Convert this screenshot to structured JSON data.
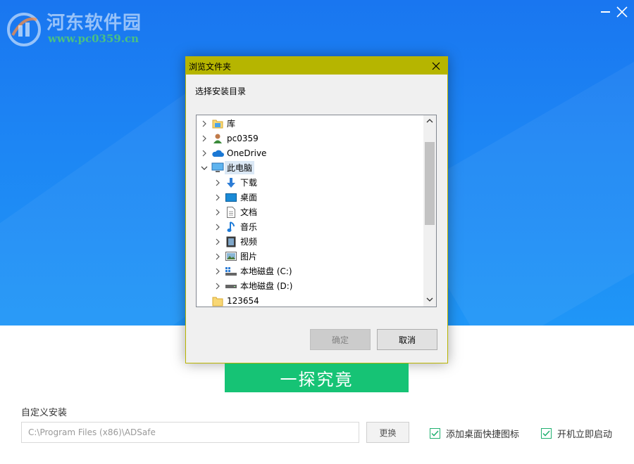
{
  "watermark": {
    "site_name": "河东软件园",
    "site_url": "www.pc0359.cn"
  },
  "window": {
    "minimize_icon": "minimize-icon",
    "close_icon": "close-icon"
  },
  "dialog": {
    "title": "浏览文件夹",
    "prompt": "选择安装目录",
    "tree": [
      {
        "label": "库",
        "icon": "library-icon",
        "level": 0,
        "expanded": false
      },
      {
        "label": "pc0359",
        "icon": "user-icon",
        "level": 0,
        "expanded": false
      },
      {
        "label": "OneDrive",
        "icon": "cloud-icon",
        "level": 0,
        "expanded": false
      },
      {
        "label": "此电脑",
        "icon": "computer-icon",
        "level": 0,
        "expanded": true,
        "selected": true
      },
      {
        "label": "下载",
        "icon": "download-icon",
        "level": 1,
        "expanded": false
      },
      {
        "label": "桌面",
        "icon": "desktop-icon",
        "level": 1,
        "expanded": false
      },
      {
        "label": "文档",
        "icon": "document-icon",
        "level": 1,
        "expanded": false
      },
      {
        "label": "音乐",
        "icon": "music-icon",
        "level": 1,
        "expanded": false
      },
      {
        "label": "视频",
        "icon": "video-icon",
        "level": 1,
        "expanded": false
      },
      {
        "label": "图片",
        "icon": "picture-icon",
        "level": 1,
        "expanded": false
      },
      {
        "label": "本地磁盘 (C:)",
        "icon": "drive-icon",
        "level": 1,
        "expanded": false
      },
      {
        "label": "本地磁盘 (D:)",
        "icon": "drive-icon",
        "level": 1,
        "expanded": false
      },
      {
        "label": "123654",
        "icon": "folder-icon",
        "level": 0,
        "expanded": null
      }
    ],
    "ok_label": "确定",
    "cancel_label": "取消",
    "title_bar_color": "#b6b500"
  },
  "main": {
    "go_label": "一探究竟",
    "custom_install_label": "自定义安装",
    "install_path": "C:\\Program Files (x86)\\ADSafe",
    "change_label": "更换",
    "options": [
      {
        "label": "添加桌面快捷图标",
        "checked": true
      },
      {
        "label": "开机立即启动",
        "checked": true
      }
    ],
    "accent_color": "#16c375",
    "hero_color": "#1d86f4"
  }
}
